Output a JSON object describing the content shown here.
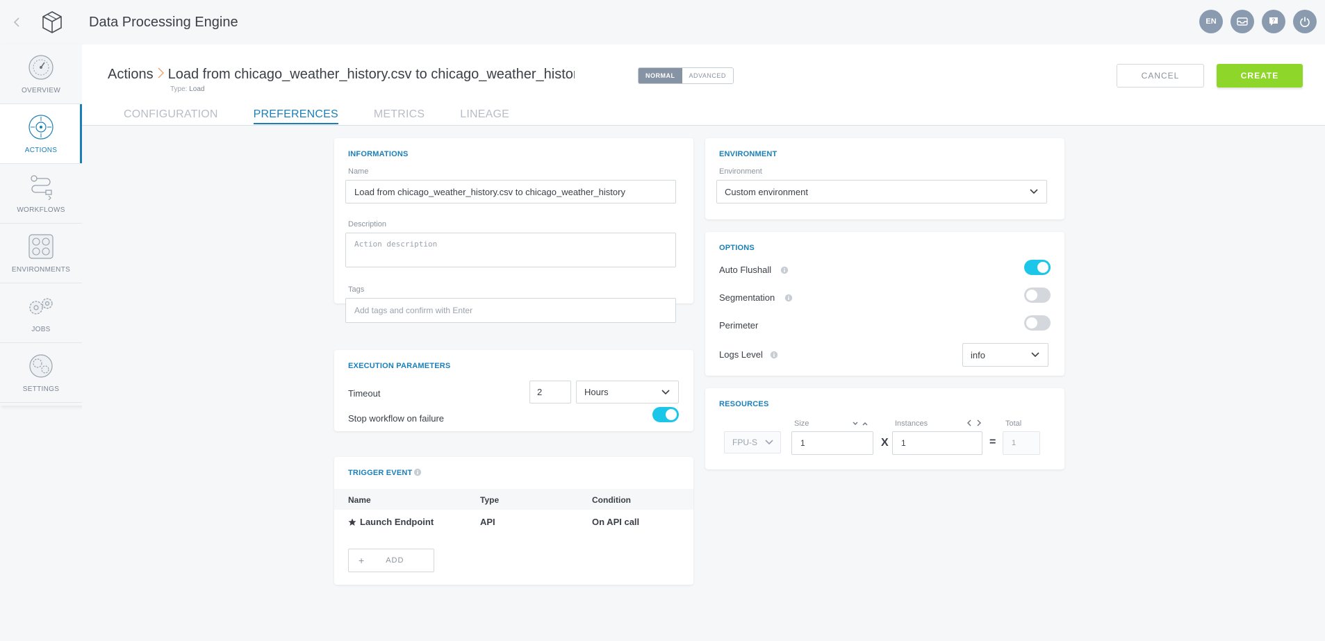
{
  "app": {
    "title": "Data Processing Engine",
    "language": "EN"
  },
  "sidebar": {
    "items": [
      {
        "label": "OVERVIEW",
        "icon": "gauge-icon"
      },
      {
        "label": "ACTIONS",
        "icon": "target-icon"
      },
      {
        "label": "WORKFLOWS",
        "icon": "workflow-icon"
      },
      {
        "label": "ENVIRONMENTS",
        "icon": "grid-icon"
      },
      {
        "label": "JOBS",
        "icon": "gears-icon"
      },
      {
        "label": "SETTINGS",
        "icon": "settings-icon"
      }
    ]
  },
  "header": {
    "breadcrumb_root": "Actions",
    "breadcrumb_current": "Load from chicago_weather_history.csv to chicago_weather_history",
    "type_label": "Type:",
    "type_value": "Load",
    "mode_normal": "NORMAL",
    "mode_advanced": "ADVANCED",
    "cancel_label": "CANCEL",
    "create_label": "CREATE",
    "tabs": [
      "CONFIGURATION",
      "PREFERENCES",
      "METRICS",
      "LINEAGE"
    ]
  },
  "informations": {
    "title": "INFORMATIONS",
    "name_label": "Name",
    "name_value": "Load from chicago_weather_history.csv to chicago_weather_history",
    "description_label": "Description",
    "description_placeholder": "Action description",
    "tags_label": "Tags",
    "tags_placeholder": "Add tags and confirm with Enter"
  },
  "execution": {
    "title": "EXECUTION PARAMETERS",
    "timeout_label": "Timeout",
    "timeout_value": "2",
    "timeout_unit": "Hours",
    "stop_label": "Stop workflow on failure",
    "stop_on": true
  },
  "trigger": {
    "title": "TRIGGER EVENT",
    "columns": [
      "Name",
      "Type",
      "Condition"
    ],
    "rows": [
      {
        "name": "Launch Endpoint",
        "type": "API",
        "condition": "On API call"
      }
    ],
    "add_label": "ADD"
  },
  "environment": {
    "title": "ENVIRONMENT",
    "label": "Environment",
    "value": "Custom environment"
  },
  "options": {
    "title": "OPTIONS",
    "auto_flushall_label": "Auto Flushall",
    "auto_flushall_on": true,
    "segmentation_label": "Segmentation",
    "segmentation_on": false,
    "perimeter_label": "Perimeter",
    "perimeter_on": false,
    "logs_level_label": "Logs Level",
    "logs_level_value": "info"
  },
  "resources": {
    "title": "RESOURCES",
    "unit": "FPU-S",
    "size_label": "Size",
    "size_value": "1",
    "instances_label": "Instances",
    "instances_value": "1",
    "total_label": "Total",
    "total_value": "1",
    "times_sign": "X",
    "equals_sign": "="
  },
  "colors": {
    "accent": "#1a7fb8",
    "create": "#8fd62a",
    "toggle_on": "#1cc6e8",
    "breadcrumb_sep": "#f0a070"
  }
}
